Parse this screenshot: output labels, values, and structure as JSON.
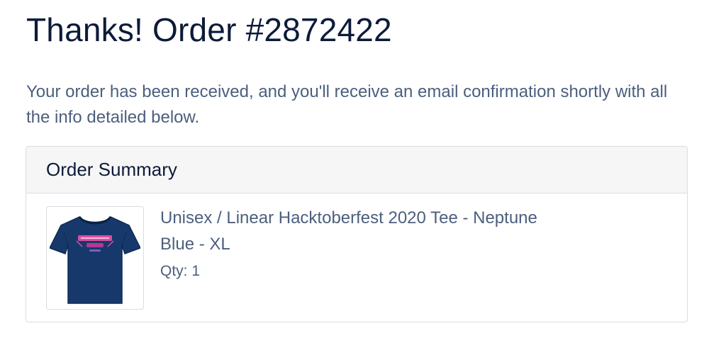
{
  "page": {
    "title": "Thanks! Order #2872422",
    "intro": "Your order has been received, and you'll receive an email confirmation shortly with all the info detailed below."
  },
  "order_summary": {
    "heading": "Order Summary",
    "items": [
      {
        "name": "Unisex / Linear Hacktoberfest 2020 Tee - Neptune Blue - XL",
        "qty": "Qty: 1",
        "image_icon": "tshirt-icon",
        "shirt_color": "#17386a",
        "print_color": "#d94fa3"
      }
    ]
  },
  "colors": {
    "heading": "#0d1b3a",
    "body_text": "#4c5f7e",
    "border": "#d8dce2",
    "header_bg": "#f6f6f6"
  }
}
